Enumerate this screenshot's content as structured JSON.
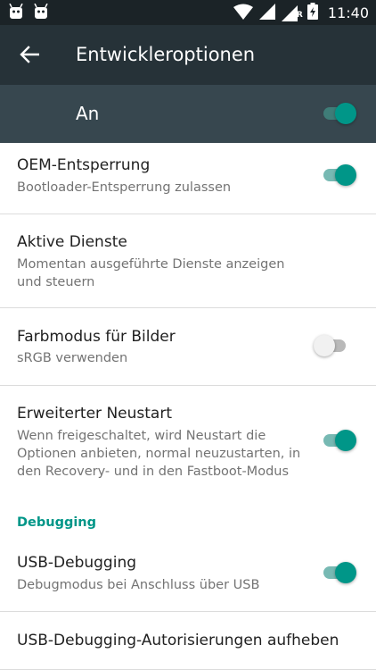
{
  "status_bar": {
    "time": "11:40",
    "left_icons": [
      "android-icon",
      "android-icon"
    ],
    "right_icons": [
      "wifi-icon",
      "signal-icon",
      "signal-roaming-icon",
      "battery-charging-icon"
    ],
    "roaming_letter": "R"
  },
  "toolbar": {
    "title": "Entwickleroptionen",
    "back_icon": "arrow-back-icon"
  },
  "master_switch": {
    "label": "An",
    "state": "on"
  },
  "settings": [
    {
      "title": "OEM-Entsperrung",
      "summary": "Bootloader-Entsperrung zulassen",
      "toggle": "on"
    },
    {
      "title": "Aktive Dienste",
      "summary": "Momentan ausgeführte Dienste anzeigen und steuern",
      "toggle": null
    },
    {
      "title": "Farbmodus für Bilder",
      "summary": "sRGB verwenden",
      "toggle": "off"
    },
    {
      "title": "Erweiterter Neustart",
      "summary": "Wenn freigeschaltet, wird Neustart die Optionen anbieten, normal neuzustarten, in den Recovery- und in den Fastboot-Modus",
      "toggle": "on"
    }
  ],
  "debugging": {
    "section_label": "Debugging",
    "items": [
      {
        "title": "USB-Debugging",
        "summary": "Debugmodus bei Anschluss über USB",
        "toggle": "on"
      },
      {
        "title": "USB-Debugging-Autorisierungen aufheben",
        "summary": "",
        "toggle": null
      }
    ]
  },
  "colors": {
    "accent": "#009688",
    "toolbar": "#263238",
    "master_bar": "#37474f",
    "status_bar": "#1b2327"
  }
}
